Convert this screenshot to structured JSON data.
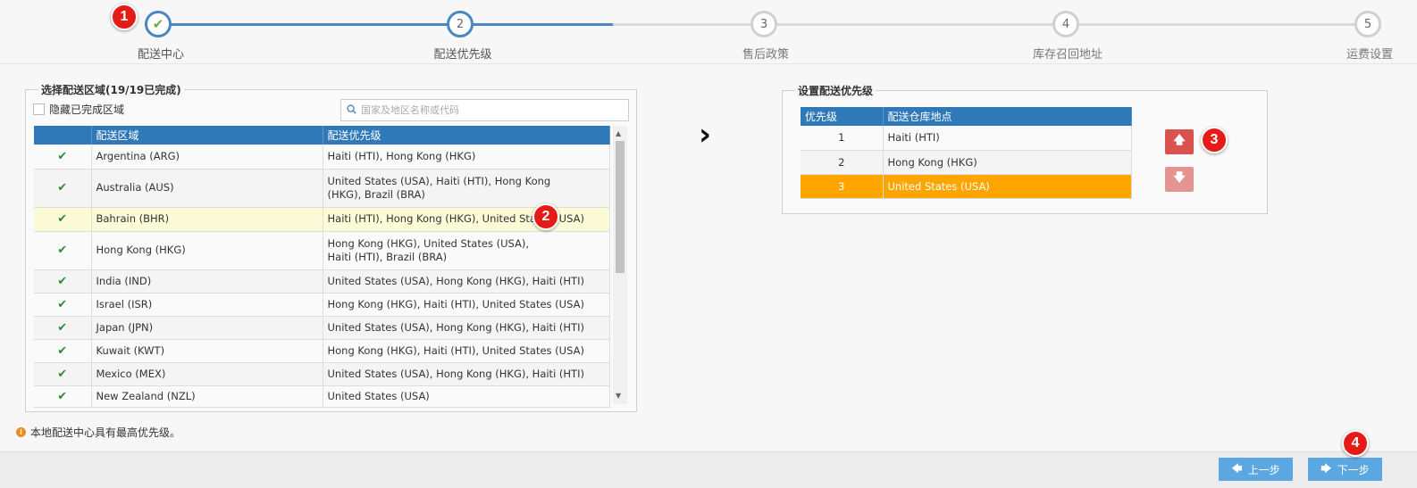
{
  "steps": [
    {
      "num": "",
      "label": "配送中心",
      "state": "done"
    },
    {
      "num": "2",
      "label": "配送优先级",
      "state": "current"
    },
    {
      "num": "3",
      "label": "售后政策",
      "state": "todo"
    },
    {
      "num": "4",
      "label": "库存召回地址",
      "state": "todo"
    },
    {
      "num": "5",
      "label": "运费设置",
      "state": "todo"
    }
  ],
  "badges": [
    "1",
    "2",
    "3",
    "4"
  ],
  "left": {
    "legend": "选择配送区域(19/19已完成)",
    "hide_label": "隐藏已完成区域",
    "search_placeholder": "国家及地区名称或代码",
    "columns": [
      "",
      "配送区域",
      "配送优先级"
    ],
    "rows": [
      {
        "region": "Argentina (ARG)",
        "priority": "Haiti (HTI), Hong Kong (HKG)"
      },
      {
        "region": "Australia (AUS)",
        "priority": "United States (USA), Haiti (HTI), Hong Kong (HKG), Brazil (BRA)"
      },
      {
        "region": "Bahrain (BHR)",
        "priority": "Haiti (HTI), Hong Kong (HKG), United States (USA)"
      },
      {
        "region": "Hong Kong (HKG)",
        "priority": "Hong Kong (HKG), United States (USA), Haiti (HTI), Brazil (BRA)"
      },
      {
        "region": "India (IND)",
        "priority": "United States (USA), Hong Kong (HKG), Haiti (HTI)"
      },
      {
        "region": "Israel (ISR)",
        "priority": "Hong Kong (HKG), Haiti (HTI), United States (USA)"
      },
      {
        "region": "Japan (JPN)",
        "priority": "United States (USA), Hong Kong (HKG), Haiti (HTI)"
      },
      {
        "region": "Kuwait (KWT)",
        "priority": "Hong Kong (HKG), Haiti (HTI), United States (USA)"
      },
      {
        "region": "Mexico (MEX)",
        "priority": "United States (USA), Hong Kong (HKG), Haiti (HTI)"
      },
      {
        "region": "New Zealand (NZL)",
        "priority": "United States (USA)"
      }
    ]
  },
  "right": {
    "legend": "设置配送优先级",
    "columns": [
      "优先级",
      "配送仓库地点"
    ],
    "rows": [
      {
        "rank": "1",
        "location": "Haiti (HTI)"
      },
      {
        "rank": "2",
        "location": "Hong Kong (HKG)"
      },
      {
        "rank": "3",
        "location": "United States (USA)"
      }
    ]
  },
  "note": "本地配送中心具有最高优先级。",
  "buttons": {
    "prev": "上一步",
    "next": "下一步"
  },
  "colors": {
    "primary": "#3079b8",
    "selected_row": "#ffa500",
    "highlight_row": "#fcfbd8",
    "badge": "#e41b17"
  }
}
